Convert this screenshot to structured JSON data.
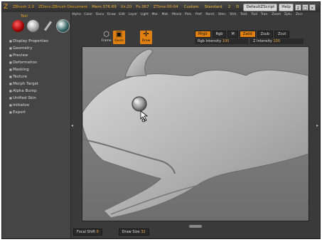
{
  "titlebar": {
    "app": "ZBrush 2.0",
    "doc": "ZDocs:ZBrush Document",
    "mem": "Mem:376.69",
    "vz": "Vz:20",
    "fs": "Fs:367",
    "ztime": "ZTime:00:04",
    "custom": "Custom",
    "standard": "Standard",
    "two": "2",
    "d": "D",
    "default_zscript": "DefaultZScript",
    "help": "Help",
    "min": "z",
    "max": "□",
    "close": "×"
  },
  "menu": [
    "Alpha",
    "Color",
    "Docu",
    "Draw",
    "Edit",
    "Layer",
    "Light",
    "Mar.",
    "Mat.",
    "Movie",
    "Pick.",
    "Pref.",
    "Rend.",
    "Sten.",
    "Strk.",
    "Text.",
    "Tool",
    "Tran.",
    "Zoom",
    "Zplu.",
    "Zscr."
  ],
  "tray": {
    "label": "Tool",
    "items": [
      "Display Properties",
      "Geometry",
      "Preview",
      "Deformation",
      "Masking",
      "Texture",
      "Morph Target",
      "Alpha Bump",
      "Unified Skin",
      "Initialize",
      "Export"
    ]
  },
  "toolbar": {
    "frame": "Frame",
    "quick": "Quick",
    "draw": "Draw",
    "modes": [
      {
        "label": "Mrgb",
        "on": true
      },
      {
        "label": "Rgb",
        "on": false
      },
      {
        "label": "M",
        "on": false
      },
      {
        "label": "Zadd",
        "on": true
      },
      {
        "label": "Zsub",
        "on": false
      },
      {
        "label": "Zcut",
        "on": false
      }
    ],
    "rgb_intensity_label": "Rgb Intensity",
    "rgb_intensity_value": "100",
    "z_intensity_label": "Z Intensity",
    "z_intensity_value": "100"
  },
  "bottom": {
    "focal_label": "Focal Shift",
    "focal_value": "0",
    "draw_size_label": "Draw Size",
    "draw_size_value": "32"
  },
  "colors": {
    "accent": "#e08010",
    "model": "#b9b9b9"
  }
}
